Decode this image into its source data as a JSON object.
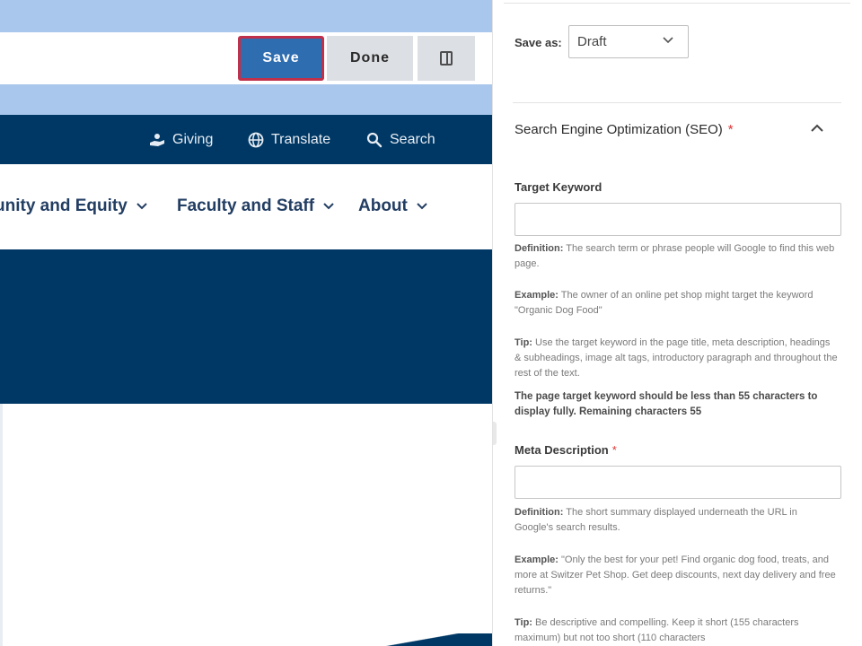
{
  "toolbar": {
    "save_label": "Save",
    "done_label": "Done"
  },
  "utility_nav": {
    "giving": "Giving",
    "translate": "Translate",
    "search": "Search"
  },
  "main_nav": {
    "items": [
      {
        "label": "unity and Equity"
      },
      {
        "label": "Faculty and Staff"
      },
      {
        "label": "About"
      }
    ]
  },
  "panel": {
    "save_as_label": "Save as:",
    "status_value": "Draft",
    "seo_section_title": "Search Engine Optimization (SEO)",
    "required_mark": "*",
    "target_keyword": {
      "label": "Target Keyword",
      "value": "",
      "definition_label": "Definition:",
      "definition_text": "The search term or phrase people will Google to find this web page.",
      "example_label": "Example:",
      "example_text": "The owner of an online pet shop might target the keyword \"Organic Dog Food\"",
      "tip_label": "Tip:",
      "tip_text": "Use the target keyword in the page title, meta description, headings & subheadings, image alt tags, introductory paragraph and throughout the rest of the text.",
      "limit_text": "The page target keyword should be less than 55 characters to display fully. Remaining characters 55"
    },
    "meta_description": {
      "label": "Meta Description",
      "value": "",
      "definition_label": "Definition:",
      "definition_text": "The short summary displayed underneath the URL in Google's search results.",
      "example_label": "Example:",
      "example_text": "\"Only the best for your pet! Find organic dog food, treats, and more at Switzer Pet Shop. Get deep discounts, next day delivery and free returns.\"",
      "tip_label": "Tip:",
      "tip_text": "Be descriptive and compelling. Keep it short (155 characters maximum) but not too short (110 characters"
    }
  },
  "colors": {
    "brand_navy": "#003865",
    "band_light_blue": "#a9c6ec",
    "save_blue": "#2e6db0",
    "focus_red": "#c0304a"
  }
}
